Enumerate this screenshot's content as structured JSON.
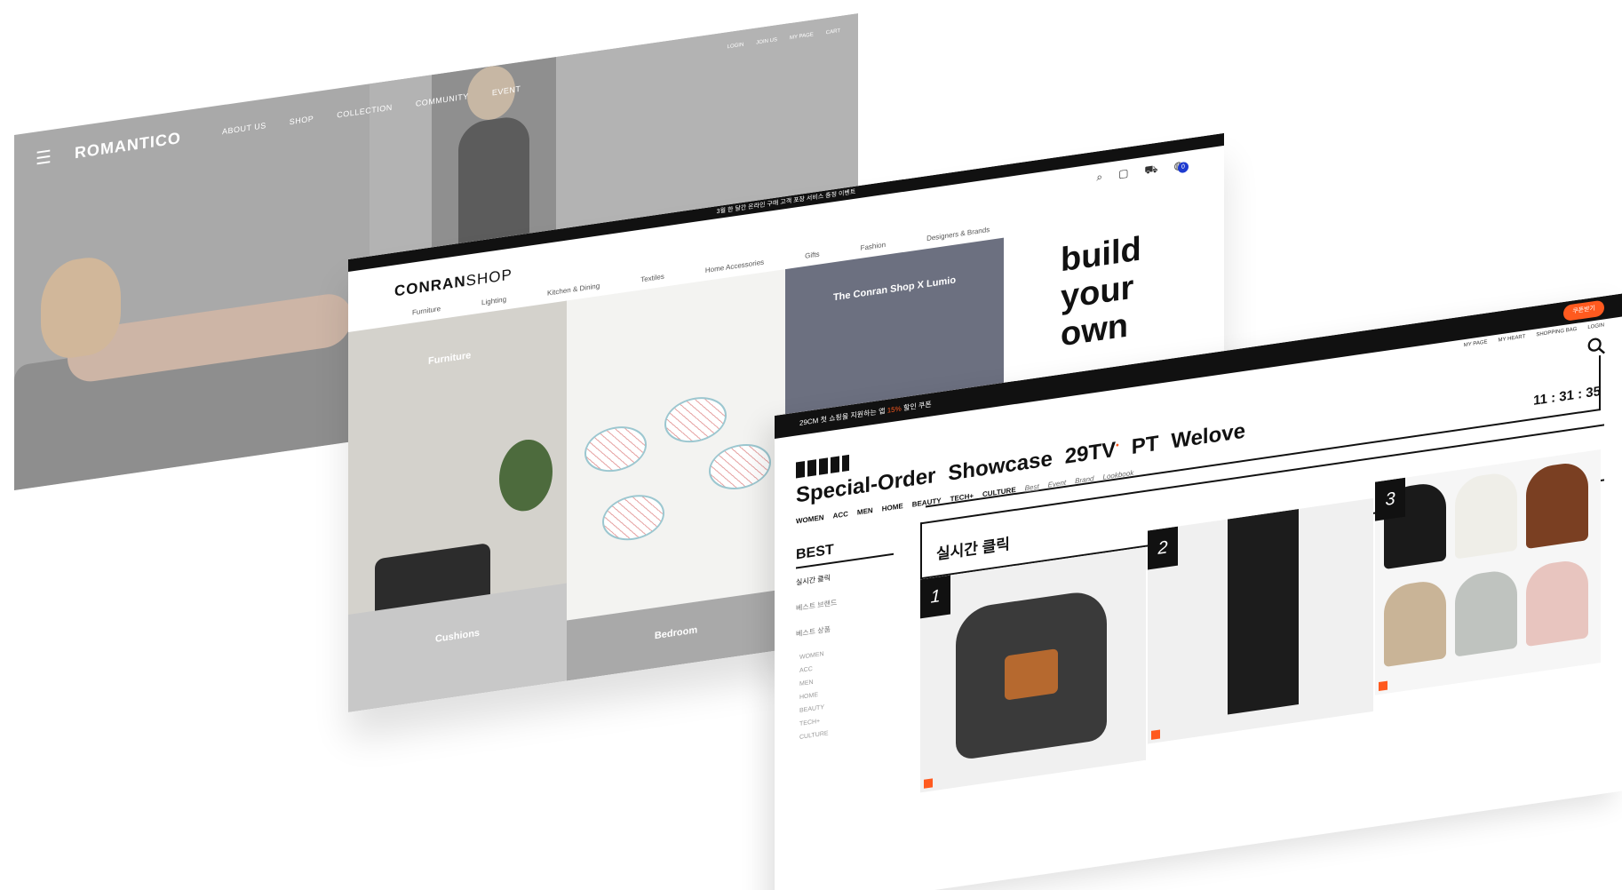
{
  "romantico": {
    "logo": "ROMANTICO",
    "nav": [
      "ABOUT US",
      "SHOP",
      "COLLECTION",
      "COMMUNITY",
      "EVENT"
    ],
    "top_links": [
      "LOGIN",
      "JOIN US",
      "MY PAGE",
      "CART"
    ]
  },
  "conran": {
    "topbar": "3월 한 달간 온라인 구매 고객 포장 서비스 증정 이벤트",
    "logo_bold": "CONRAN",
    "logo_light": "SHOP",
    "menu": [
      "Furniture",
      "Lighting",
      "Kitchen & Dining",
      "Textiles",
      "Home Accessories",
      "Gifts",
      "Fashion",
      "Designers & Brands"
    ],
    "cart_count": "0",
    "tiles": {
      "furniture": "Furniture",
      "cushions": "Cushions",
      "bedroom": "Bedroom",
      "lumio": "The Conran Shop X Lumio"
    },
    "headline": [
      "build",
      "your",
      "own"
    ]
  },
  "m29": {
    "topbar_prefix": "29CM 첫 쇼핑을 지원하는 앱",
    "topbar_pct": "15%",
    "topbar_suffix": "할인 쿠폰",
    "coupon": "쿠폰받기",
    "util": [
      "MY PAGE",
      "MY HEART",
      "SHOPPING BAG",
      "LOGIN"
    ],
    "categories": [
      "Special-Order",
      "Showcase",
      "29TV",
      "PT",
      "Welove"
    ],
    "tv_mark": "•",
    "subnav_main": [
      "WOMEN",
      "ACC",
      "MEN",
      "HOME",
      "BEAUTY",
      "TECH+",
      "CULTURE"
    ],
    "subnav_links": [
      "Best",
      "Event",
      "Brand",
      "Lookbook"
    ],
    "timer": "11 : 31 : 35",
    "sidebar": {
      "title": "BEST",
      "rows": [
        "실시간 클릭",
        "베스트 브랜드",
        "베스트 상품"
      ],
      "subs": [
        "WOMEN",
        "ACC",
        "MEN",
        "HOME",
        "BEAUTY",
        "TECH+",
        "CULTURE"
      ]
    },
    "section_title": "실시간 클릭",
    "ranks": [
      "1",
      "2",
      "3"
    ]
  },
  "colors": {
    "accent": "#ff5a1f",
    "badge": "#1e3bd0"
  }
}
